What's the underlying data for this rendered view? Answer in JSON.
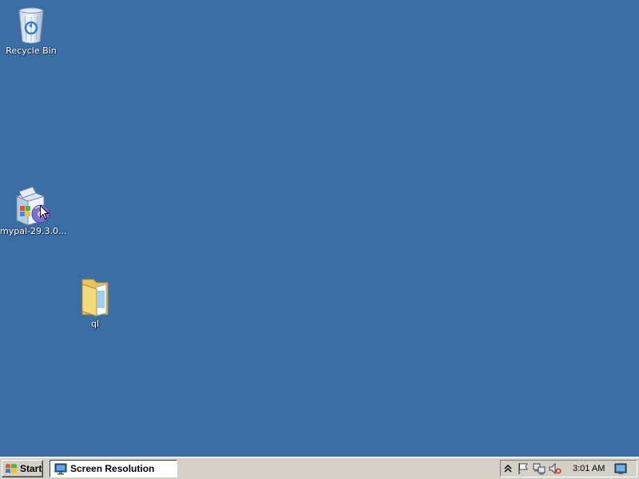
{
  "desktop": {
    "background_color": "#3a6ea5",
    "icons": [
      {
        "label": "Recycle Bin",
        "icon": "recycle-bin-icon"
      },
      {
        "label": "mypal-29.3.0...",
        "icon": "installer-package-icon"
      },
      {
        "label": "ql",
        "icon": "folder-icon"
      }
    ]
  },
  "taskbar": {
    "start_label": "Start",
    "tasks": [
      {
        "label": "Screen Resolution",
        "icon": "display-settings-icon",
        "active": true
      }
    ],
    "tray": {
      "icons": [
        "show-hidden-icons-chevron",
        "action-center-flag-icon",
        "network-icon",
        "volume-muted-icon"
      ],
      "clock": "3:01 AM"
    }
  }
}
